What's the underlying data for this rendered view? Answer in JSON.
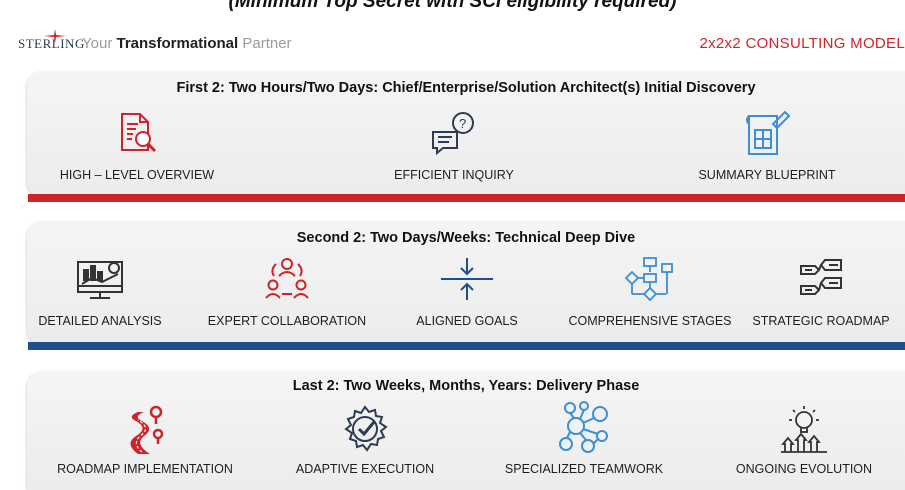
{
  "banner": "(Minimum Top Secret with SCI eligibility required)",
  "header": {
    "logo": "STERLING",
    "tagline_pre": "Your ",
    "tagline_bold": "Transformational",
    "tagline_post": " Partner",
    "model_title": "2x2x2 CONSULTING MODEL"
  },
  "phases": [
    {
      "title": "First 2: Two Hours/Two Days: Chief/Enterprise/Solution Architect(s) Initial Discovery",
      "bar_color": "#cf2229",
      "items": [
        {
          "label": "HIGH – LEVEL OVERVIEW",
          "icon": "document-search-icon"
        },
        {
          "label": "EFFICIENT INQUIRY",
          "icon": "chat-question-icon"
        },
        {
          "label": "SUMMARY BLUEPRINT",
          "icon": "blueprint-icon"
        }
      ]
    },
    {
      "title": "Second 2: Two Days/Weeks: Technical Deep Dive",
      "bar_color": "#1f4e8c",
      "items": [
        {
          "label": "DETAILED ANALYSIS",
          "icon": "analytics-monitor-icon"
        },
        {
          "label": "EXPERT COLLABORATION",
          "icon": "team-collaboration-icon"
        },
        {
          "label": "ALIGNED GOALS",
          "icon": "aligned-arrows-icon"
        },
        {
          "label": "COMPREHENSIVE STAGES",
          "icon": "flowchart-icon"
        },
        {
          "label": "STRATEGIC ROADMAP",
          "icon": "roadmap-signs-icon"
        }
      ]
    },
    {
      "title": "Last 2: Two Weeks, Months, Years: Delivery Phase",
      "items": [
        {
          "label": "ROADMAP IMPLEMENTATION",
          "icon": "winding-road-icon"
        },
        {
          "label": "ADAPTIVE EXECUTION",
          "icon": "gear-check-icon"
        },
        {
          "label": "SPECIALIZED TEAMWORK",
          "icon": "network-people-icon"
        },
        {
          "label": "ONGOING EVOLUTION",
          "icon": "lightbulb-growth-icon"
        }
      ]
    }
  ],
  "colors": {
    "red": "#cf2229",
    "blue": "#1f4e8c",
    "light_blue": "#3a8fd6",
    "dark_icon": "#333333"
  }
}
